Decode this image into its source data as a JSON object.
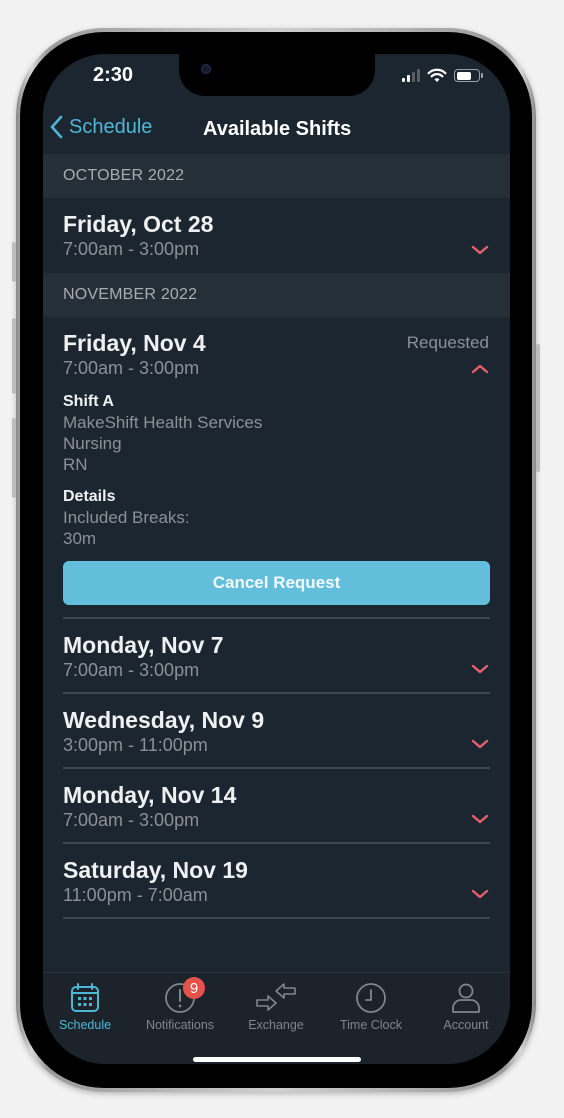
{
  "status_bar": {
    "time": "2:30"
  },
  "nav": {
    "back_label": "Schedule",
    "title": "Available Shifts"
  },
  "colors": {
    "accent": "#4fb7d6",
    "chevron": "#e8606a",
    "button": "#62bedb",
    "badge": "#e5524c",
    "background": "#1c2630"
  },
  "sections": [
    {
      "header": "OCTOBER 2022",
      "shifts": [
        {
          "date": "Friday, Oct 28",
          "time": "7:00am - 3:00pm",
          "expanded": false
        }
      ]
    },
    {
      "header": "NOVEMBER 2022",
      "shifts": [
        {
          "date": "Friday, Nov 4",
          "time": "7:00am - 3:00pm",
          "status": "Requested",
          "expanded": true,
          "details": {
            "shift_label": "Shift A",
            "organization": "MakeShift Health Services",
            "department": "Nursing",
            "role": "RN",
            "details_label": "Details",
            "breaks_label": "Included Breaks:",
            "breaks_value": "30m",
            "cancel_label": "Cancel Request"
          }
        },
        {
          "date": "Monday, Nov 7",
          "time": "7:00am - 3:00pm",
          "expanded": false
        },
        {
          "date": "Wednesday, Nov 9",
          "time": "3:00pm - 11:00pm",
          "expanded": false
        },
        {
          "date": "Monday, Nov 14",
          "time": "7:00am - 3:00pm",
          "expanded": false
        },
        {
          "date": "Saturday, Nov 19",
          "time": "11:00pm - 7:00am",
          "expanded": false
        }
      ]
    }
  ],
  "tab_bar": {
    "tabs": [
      {
        "label": "Schedule",
        "icon": "calendar-icon",
        "active": true
      },
      {
        "label": "Notifications",
        "icon": "alert-circle-icon",
        "badge": "9"
      },
      {
        "label": "Exchange",
        "icon": "exchange-arrows-icon"
      },
      {
        "label": "Time Clock",
        "icon": "clock-icon"
      },
      {
        "label": "Account",
        "icon": "person-icon"
      }
    ]
  }
}
